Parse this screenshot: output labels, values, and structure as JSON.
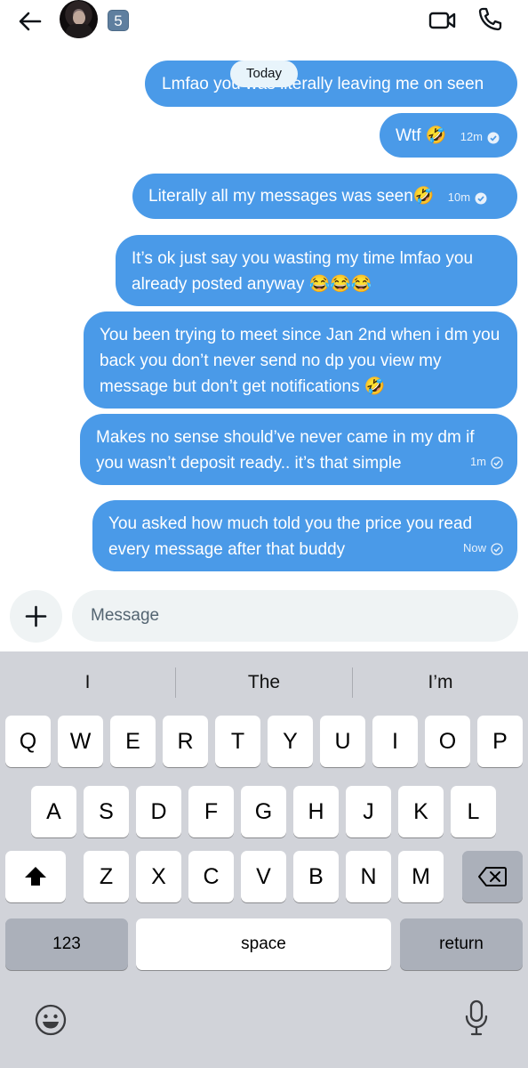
{
  "header": {
    "badge_count": "5"
  },
  "date_separator": "Today",
  "messages": [
    {
      "text": "Lmfao you was literally leaving me on seen",
      "time": ""
    },
    {
      "text": "Wtf 🤣",
      "time": "12m"
    },
    {
      "text": "Literally all my messages was seen🤣",
      "time": "10m"
    },
    {
      "text": "It’s ok just say you wasting my time lmfao you already posted anyway 😂😂😂",
      "time": ""
    },
    {
      "text": "You been trying to meet since Jan 2nd when i dm you back you don’t never send no dp you view my message but don’t get notifications 🤣",
      "time": ""
    },
    {
      "text": "Makes no sense should’ve never came in my dm if you wasn’t deposit ready.. it’s that simple",
      "time": "1m"
    },
    {
      "text": "You asked how much told you the price you read every message after that buddy",
      "time": "Now"
    }
  ],
  "composer": {
    "placeholder": "Message"
  },
  "keyboard": {
    "suggestions": [
      "I",
      "The",
      "I’m"
    ],
    "row1": [
      "Q",
      "W",
      "E",
      "R",
      "T",
      "Y",
      "U",
      "I",
      "O",
      "P"
    ],
    "row2": [
      "A",
      "S",
      "D",
      "F",
      "G",
      "H",
      "J",
      "K",
      "L"
    ],
    "row3": [
      "Z",
      "X",
      "C",
      "V",
      "B",
      "N",
      "M"
    ],
    "numbers_label": "123",
    "space_label": "space",
    "return_label": "return"
  },
  "colors": {
    "bubble": "#4a9ae8",
    "keyboard_bg": "#d1d3d9"
  },
  "icons": [
    "back-arrow-icon",
    "video-call-icon",
    "phone-icon",
    "plus-icon",
    "shift-icon",
    "backspace-icon",
    "emoji-icon",
    "microphone-icon",
    "read-check-icon"
  ]
}
